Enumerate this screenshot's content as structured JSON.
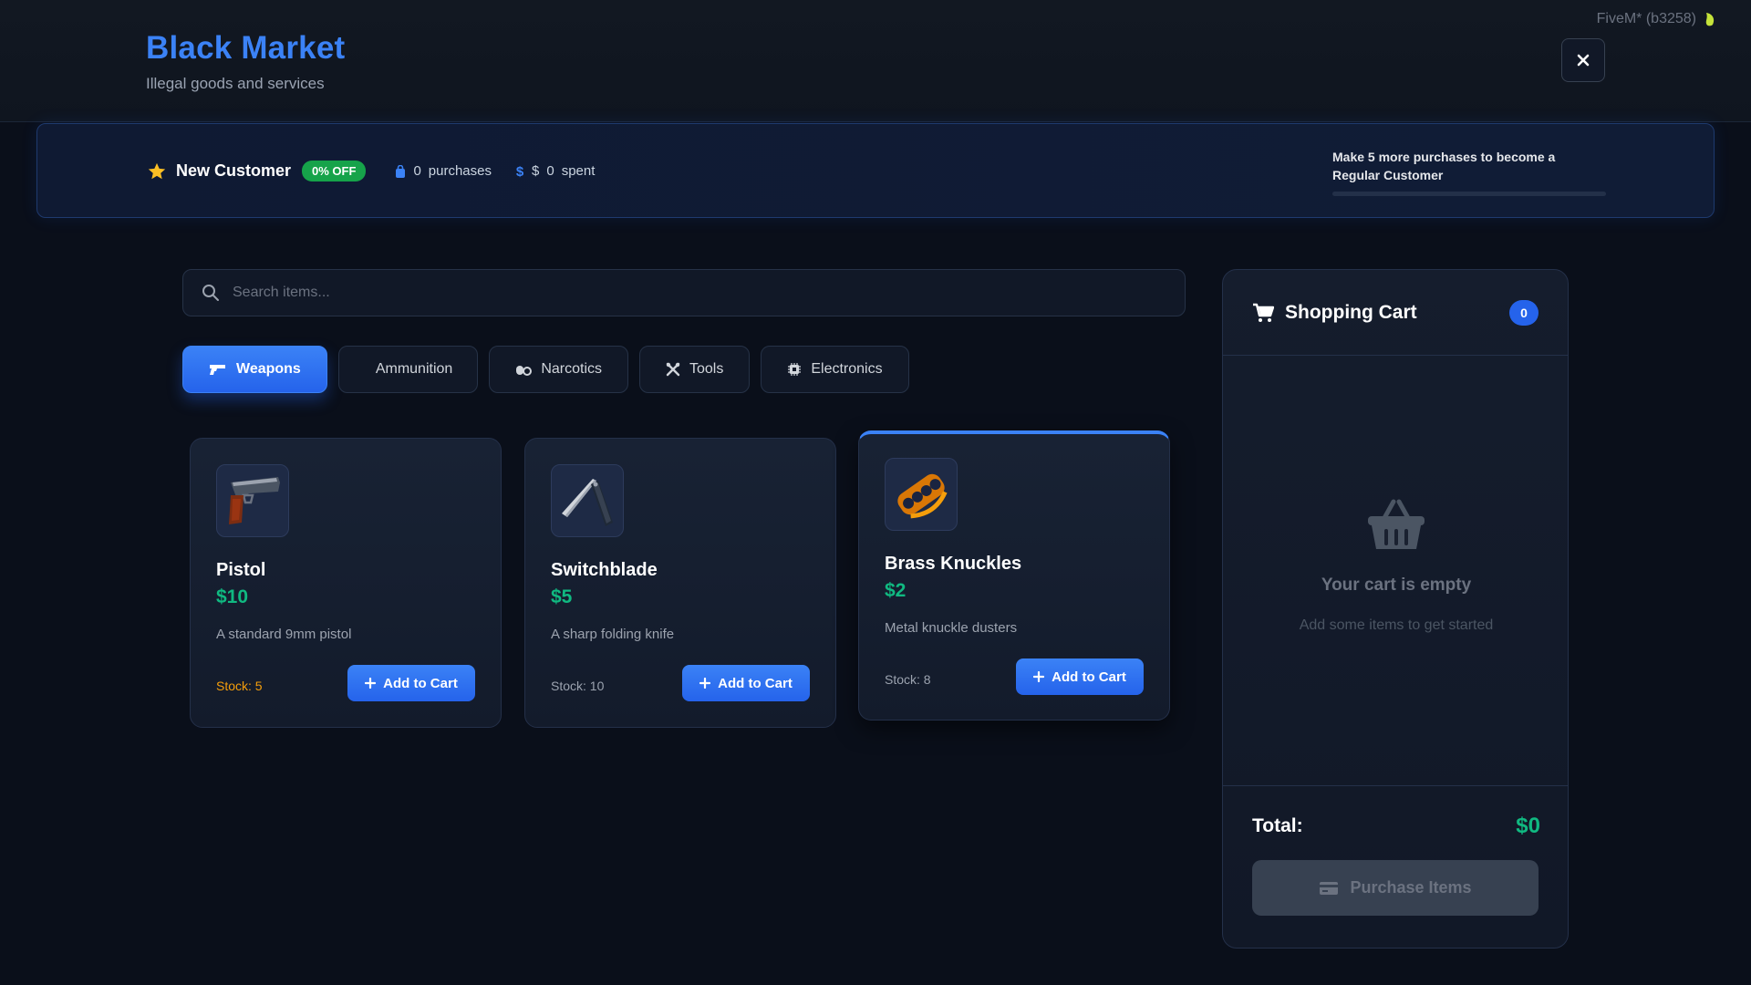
{
  "header": {
    "title": "Black Market",
    "subtitle": "Illegal goods and services",
    "client_tag": "FiveM* (b3258)"
  },
  "loyalty": {
    "tier": "New Customer",
    "discount": "0% OFF",
    "purchases_count": "0",
    "purchases_label": "purchases",
    "spent_currency": "$",
    "spent_amount": "0",
    "spent_label": "spent",
    "progress_text": "Make 5 more purchases to become a Regular Customer",
    "progress_fraction": 0
  },
  "search": {
    "placeholder": "Search items..."
  },
  "categories": [
    {
      "label": "Weapons",
      "icon": "gun-icon",
      "active": true
    },
    {
      "label": "Ammunition",
      "icon": "",
      "active": false
    },
    {
      "label": "Narcotics",
      "icon": "pills-icon",
      "active": false
    },
    {
      "label": "Tools",
      "icon": "tools-icon",
      "active": false
    },
    {
      "label": "Electronics",
      "icon": "chip-icon",
      "active": false
    }
  ],
  "items": [
    {
      "name": "Pistol",
      "price": "$10",
      "description": "A standard 9mm pistol",
      "stock": "Stock: 5",
      "button": "Add to Cart",
      "image": "pistol-icon"
    },
    {
      "name": "Switchblade",
      "price": "$5",
      "description": "A sharp folding knife",
      "stock": "Stock: 10",
      "button": "Add to Cart",
      "image": "knife-icon"
    },
    {
      "name": "Brass Knuckles",
      "price": "$2",
      "description": "Metal knuckle dusters",
      "stock": "Stock: 8",
      "button": "Add to Cart",
      "image": "brass-knuckles-icon"
    }
  ],
  "cart": {
    "title": "Shopping Cart",
    "count": "0",
    "empty_title": "Your cart is empty",
    "empty_subtitle": "Add some items to get started",
    "total_label": "Total:",
    "total_value": "$0",
    "purchase_label": "Purchase Items"
  },
  "colors": {
    "accent": "#3b82f6",
    "price_green": "#10b981",
    "low_stock": "#f59e0b",
    "background": "#0a0f1a"
  }
}
